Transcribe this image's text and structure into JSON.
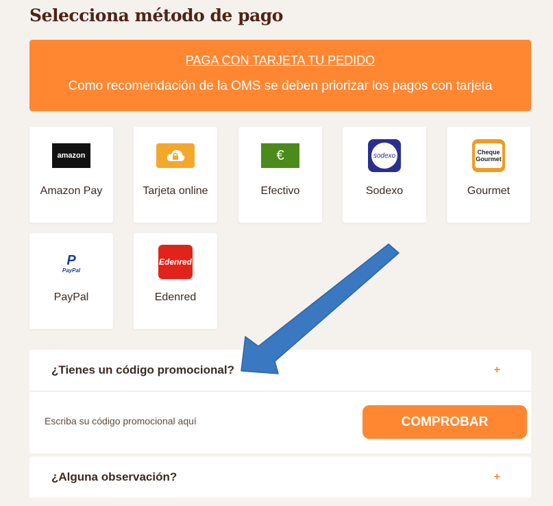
{
  "page": {
    "title": "Selecciona método de pago"
  },
  "banner": {
    "title": "PAGA CON TARJETA TU PEDIDO",
    "subtitle": "Como recomendación de la OMS se deben priorizar los pagos con tarjeta"
  },
  "methods": [
    {
      "label": "Amazon Pay",
      "icon": "amazon-logo",
      "logo_text": "amazon"
    },
    {
      "label": "Tarjeta online",
      "icon": "cloud-lock-icon"
    },
    {
      "label": "Efectivo",
      "icon": "euro-icon",
      "logo_text": "€"
    },
    {
      "label": "Sodexo",
      "icon": "sodexo-logo",
      "logo_text": "sodexo"
    },
    {
      "label": "Gourmet",
      "icon": "cheque-gourmet-logo",
      "logo_text": "Cheque Gourmet"
    },
    {
      "label": "PayPal",
      "icon": "paypal-logo",
      "logo_text": "PayPal"
    },
    {
      "label": "Edenred",
      "icon": "edenred-logo",
      "logo_text": "Edenred"
    }
  ],
  "promo": {
    "title": "¿Tienes un código promocional?",
    "placeholder": "Escriba su código promocional aquí",
    "button": "COMPROBAR",
    "toggle": "+"
  },
  "observations": {
    "title": "¿Alguna observación?",
    "toggle": "+"
  },
  "colors": {
    "accent": "#ff8732",
    "title": "#502314",
    "background": "#f5f2ee",
    "arrow": "#3a78c2"
  }
}
